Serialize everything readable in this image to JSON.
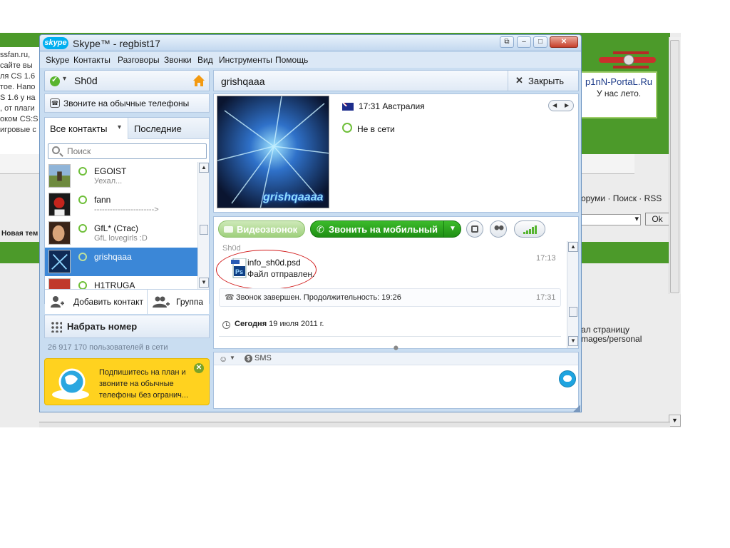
{
  "background": {
    "left_text": [
      "ssfan.ru,",
      "сайте вы",
      "ля CS 1.6",
      "тое. Напо",
      "S 1.6 у на",
      ", от плаги",
      "оком CS:S",
      "игровые с"
    ],
    "ad_line1": "p1nN-PortaL.Ru",
    "ad_line2": "У нас лето.",
    "links": "оруми · Поиск · RSS",
    "ok_button": "Ok",
    "new_topic": "Новая тем",
    "page_text_1": "ал страницу",
    "page_text_2": "mages/personal"
  },
  "window": {
    "logo": "skype",
    "title": "Skype™ - regbist17",
    "restore_glyph": "⧉",
    "minimize_glyph": "–",
    "maximize_glyph": "□",
    "close_glyph": "✕"
  },
  "menu": [
    "Skype",
    "Контакты",
    "Разговоры",
    "Звонки",
    "Вид",
    "Инструменты",
    "Помощь"
  ],
  "profile": {
    "caret": "▾",
    "name": "Sh0d",
    "call_phones": "Звоните на обычные телефоны"
  },
  "tabs": {
    "all": "Все контакты",
    "all_caret": "▾",
    "recent": "Последние"
  },
  "search": {
    "placeholder": "Поиск"
  },
  "contacts": [
    {
      "name": "EGOIST",
      "mood": "Уехал..."
    },
    {
      "name": "fann",
      "mood": "-----------------------> "
    },
    {
      "name": "GfL* (Стас)",
      "mood": "GfL lovegirls :D"
    },
    {
      "name": "grishqaaa",
      "mood": ""
    },
    {
      "name": "H1TRUGA",
      "mood": ""
    }
  ],
  "scroll": {
    "up": "▲",
    "down": "▼"
  },
  "actions": {
    "add_contact": "Добавить контакт",
    "group": "Группа",
    "dial": "Набрать номер",
    "online_count": "26 917 170 пользователей в сети"
  },
  "promo": {
    "text": "Подпишитесь на план и звоните на обычные телефоны без огранич...",
    "close": "✕"
  },
  "chat": {
    "contact_name": "grishqaaa",
    "close_x": "✕",
    "close_label": "Закрыть",
    "avatar_caption": "grishqaaaa",
    "local_time": "17:31 Австралия",
    "nav_prev": "◀",
    "nav_next": "▶",
    "status": "Не в сети",
    "video_call": "Видеозвонок",
    "call_mobile": "Звонить на мобильный",
    "phone_glyph": "✆",
    "drop_caret": "▼",
    "sender": "Sh0d",
    "file_name": "info_sh0d.psd",
    "file_status": "Файл отправлен.",
    "file_time": "17:13",
    "call_glyph": "☎",
    "call_ended": "Звонок завершен. Продолжительность: 19:26",
    "call_time": "17:31",
    "date_today": "Сегодня",
    "date_rest": " 19 июля 2011 г.",
    "grip": "⬤",
    "emoticon": "☺",
    "emoticon_caret": "▼",
    "sms_glyph": "$",
    "sms": "SMS"
  },
  "colors": {
    "skype_blue": "#00aff0",
    "call_green": "#1f8f15",
    "selection_blue": "#3b87d7",
    "promo_yellow": "#ffd21f",
    "forum_green": "#4c9a2a"
  }
}
